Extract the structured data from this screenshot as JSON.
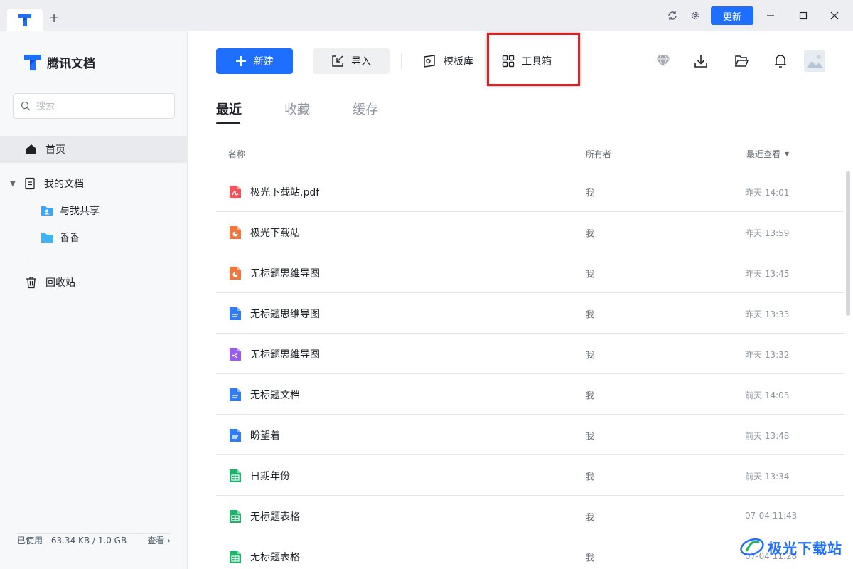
{
  "titlebar": {
    "update_label": "更新"
  },
  "sidebar": {
    "brand": "腾讯文档",
    "search_placeholder": "搜索",
    "items": [
      {
        "label": "首页",
        "icon": "home-icon",
        "active": true
      },
      {
        "label": "我的文档",
        "icon": "document-icon"
      },
      {
        "label": "与我共享",
        "icon": "shared-folder-icon"
      },
      {
        "label": "香香",
        "icon": "folder-icon"
      },
      {
        "label": "回收站",
        "icon": "trash-icon"
      }
    ],
    "storage": {
      "label": "已使用",
      "usage": "63.34 KB / 1.0 GB",
      "link": "查看 ›",
      "used_fraction": 0.0001
    }
  },
  "toolbar": {
    "new_label": "新建",
    "import_label": "导入",
    "templates_label": "模板库",
    "toolbox_label": "工具箱"
  },
  "tabs": {
    "recent": "最近",
    "favorites": "收藏",
    "cache": "缓存"
  },
  "table": {
    "col_name": "名称",
    "col_owner": "所有者",
    "col_time": "最近查看",
    "rows": [
      {
        "name": "极光下载站.pdf",
        "type": "pdf",
        "owner": "我",
        "time": "昨天 14:01"
      },
      {
        "name": "极光下载站",
        "type": "slides",
        "owner": "我",
        "time": "昨天 13:59"
      },
      {
        "name": "无标题思维导图",
        "type": "slides",
        "owner": "我",
        "time": "昨天 13:45"
      },
      {
        "name": "无标题思维导图",
        "type": "doc",
        "owner": "我",
        "time": "昨天 13:33"
      },
      {
        "name": "无标题思维导图",
        "type": "mindmap",
        "owner": "我",
        "time": "昨天 13:32"
      },
      {
        "name": "无标题文档",
        "type": "doc",
        "owner": "我",
        "time": "前天 14:03"
      },
      {
        "name": "盼望着",
        "type": "doc",
        "owner": "我",
        "time": "前天 13:48"
      },
      {
        "name": "日期年份",
        "type": "sheet",
        "owner": "我",
        "time": "前天 13:34"
      },
      {
        "name": "无标题表格",
        "type": "sheet",
        "owner": "我",
        "time": "07-04 11:43"
      },
      {
        "name": "无标题表格",
        "type": "sheet",
        "owner": "我",
        "time": "07-04 11:28"
      }
    ]
  },
  "watermark": {
    "text": "极光下载站"
  },
  "colors": {
    "accent": "#1e6fff",
    "pdf": "#f2545b",
    "slides": "#f0773c",
    "doc": "#2f7cf6",
    "mindmap": "#9a5cf0",
    "sheet": "#20b26b",
    "highlight": "#e02020"
  }
}
